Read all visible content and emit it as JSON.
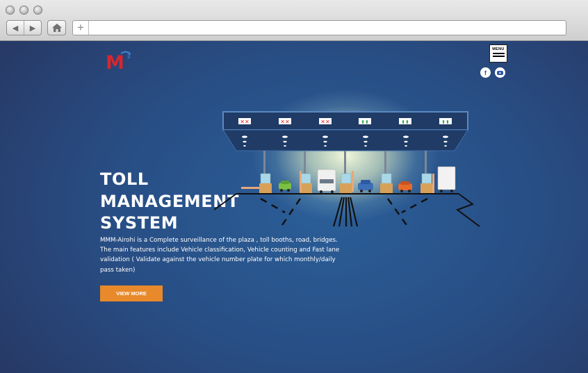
{
  "browser": {
    "back_icon": "back-arrow-icon",
    "forward_icon": "forward-arrow-icon",
    "home_icon": "home-icon",
    "new_tab_label": "+",
    "address_value": ""
  },
  "header": {
    "logo_text": "M",
    "menu_label": "MENU",
    "social": [
      {
        "name": "facebook",
        "glyph": "f",
        "icon": "facebook-icon"
      },
      {
        "name": "youtube",
        "icon": "youtube-icon"
      }
    ]
  },
  "hero": {
    "title_lines": [
      "TOLL",
      "MANAGEMENT",
      "SYSTEM"
    ],
    "description": "MMM-Airohi is a Complete surveillance of the plaza , toll booths, road, bridges. The main features include Vehicle classification, Vehicle counting and Fast lane validation ( Validate against the vehicle number plate for which monthly/daily pass taken)",
    "cta_label": "VIEW MORE"
  },
  "colors": {
    "accent": "#e8892b",
    "background": "#2b4a78",
    "gantry": "#1f3b66",
    "lane_closed": "#d8262e",
    "lane_open": "#2e9b4a"
  }
}
